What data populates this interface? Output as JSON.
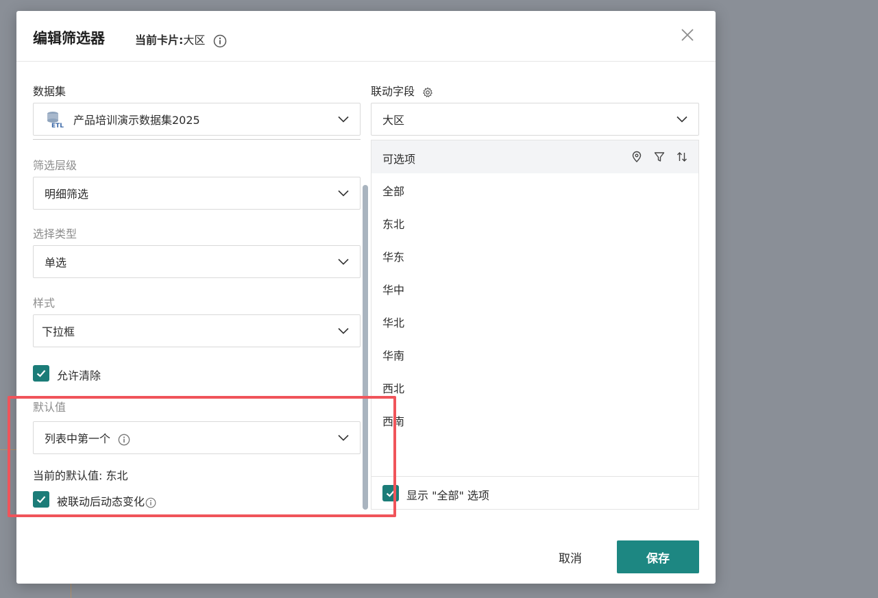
{
  "modal": {
    "title": "编辑筛选器",
    "current_card_label": "当前卡片:",
    "current_card_value": "大区"
  },
  "left": {
    "dataset_label": "数据集",
    "dataset_icon_text": "ETL",
    "dataset_value": "产品培训演示数据集2025",
    "filter_level_label": "筛选层级",
    "filter_level_value": "明细筛选",
    "select_type_label": "选择类型",
    "select_type_value": "单选",
    "style_label": "样式",
    "style_value": "下拉框",
    "allow_clear_label": "允许清除",
    "allow_clear_checked": true,
    "default_label": "默认值",
    "default_value": "列表中第一个",
    "current_default_text": "当前的默认值: 东北",
    "dynamic_change_label": "被联动后动态变化",
    "dynamic_change_checked": true
  },
  "right": {
    "linked_field_label": "联动字段",
    "linked_field_value": "大区",
    "options_header": "可选项",
    "options": [
      "全部",
      "东北",
      "华东",
      "华中",
      "华北",
      "华南",
      "西北",
      "西南"
    ],
    "show_all_label": "显示 \"全部\" 选项",
    "show_all_checked": true
  },
  "footer": {
    "cancel_label": "取消",
    "save_label": "保存"
  },
  "colors": {
    "accent": "#1d8782",
    "highlight": "#f0545a",
    "overlay": "#8a8f97"
  },
  "icons": [
    "info-icon",
    "close-icon",
    "database-icon",
    "chevron-down-icon",
    "gear-icon",
    "location-pin-icon",
    "filter-icon",
    "sort-icon",
    "check-icon"
  ]
}
